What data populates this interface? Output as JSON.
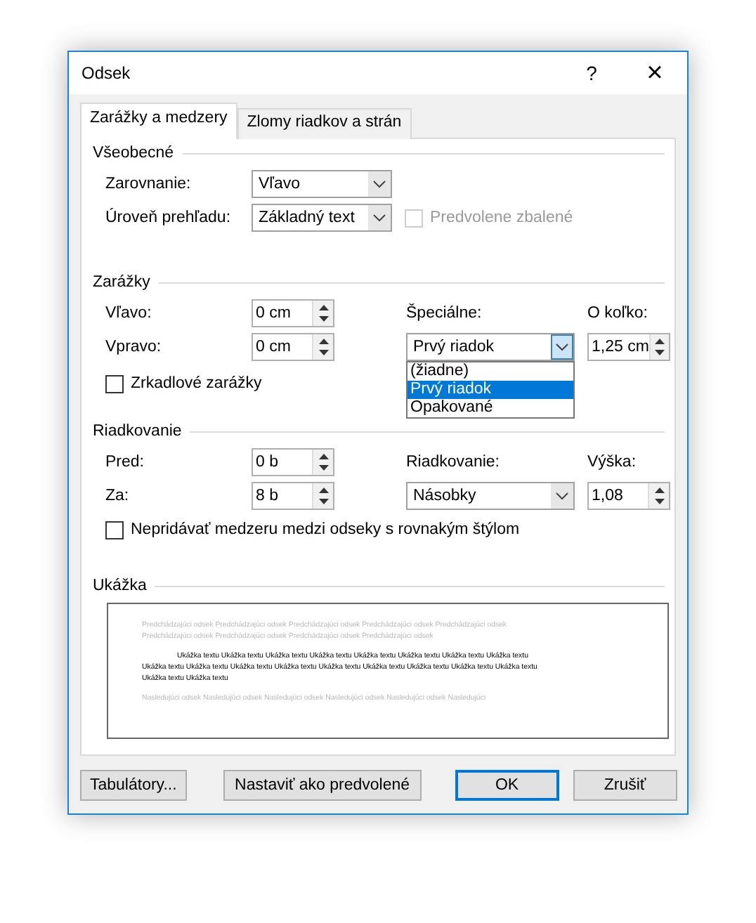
{
  "window": {
    "title": "Odsek",
    "help": "?",
    "close": "×"
  },
  "tabs": [
    {
      "label": "Zarážky a medzery",
      "selected": true
    },
    {
      "label": "Zlomy riadkov a strán",
      "selected": false
    }
  ],
  "general": {
    "heading": "Všeobecné",
    "alignment": {
      "label": "Zarovnanie:",
      "value": "Vľavo"
    },
    "outline": {
      "label": "Úroveň prehľadu:",
      "value": "Základný text"
    },
    "collapsed": {
      "label": "Predvolene zbalené",
      "checked": false,
      "disabled": true
    }
  },
  "indentation": {
    "heading": "Zarážky",
    "left": {
      "label": "Vľavo:",
      "value": "0 cm"
    },
    "right": {
      "label": "Vpravo:",
      "value": "0 cm"
    },
    "special": {
      "label": "Špeciálne:",
      "value": "Prvý riadok",
      "expanded": true,
      "options": [
        {
          "label": "(žiadne)",
          "selected": false
        },
        {
          "label": "Prvý riadok",
          "selected": true
        },
        {
          "label": "Opakované",
          "selected": false
        }
      ]
    },
    "by": {
      "label": "O koľko:",
      "value": "1,25 cm"
    },
    "mirror": {
      "label": "Zrkadlové zarážky",
      "checked": false
    }
  },
  "spacing": {
    "heading": "Riadkovanie",
    "before": {
      "label": "Pred:",
      "value": "0 b"
    },
    "after": {
      "label": "Za:",
      "value": "8 b"
    },
    "line_spacing": {
      "label": "Riadkovanie:",
      "value": "Násobky"
    },
    "at": {
      "label": "Výška:",
      "value": "1,08"
    },
    "dont_add": {
      "label": "Nepridávať medzeru medzi odseky s rovnakým štýlom",
      "checked": false
    }
  },
  "preview": {
    "heading": "Ukážka",
    "paragraphs": [
      {
        "kind": "previous",
        "lines": [
          "Predchádzajúci odsek Predchádzajúci odsek Predchádzajúci odsek Predchádzajúci odsek Predchádzajúci odsek",
          "Predchádzajúci odsek Predchádzajúci odsek Predchádzajúci odsek Predchádzajúci odsek"
        ]
      },
      {
        "kind": "sample",
        "lines": [
          "Ukážka textu Ukážka textu Ukážka textu Ukážka textu Ukážka textu Ukážka textu Ukážka textu Ukážka textu",
          "Ukážka textu Ukážka textu Ukážka textu Ukážka textu Ukážka textu Ukážka textu Ukážka textu Ukážka textu Ukážka textu",
          "Ukážka textu Ukážka textu"
        ]
      },
      {
        "kind": "following",
        "lines": [
          "Nasledujúci odsek Nasledujúci odsek Nasledujúci odsek Nasledujúci odsek Nasledujúci odsek Nasledujúci"
        ]
      }
    ]
  },
  "buttons": [
    {
      "label": "Tabulátory...",
      "default": false
    },
    {
      "label": "Nastaviť ako predvolené",
      "default": false
    },
    {
      "label": "OK",
      "default": true
    },
    {
      "label": "Zrušiť",
      "default": false
    }
  ]
}
